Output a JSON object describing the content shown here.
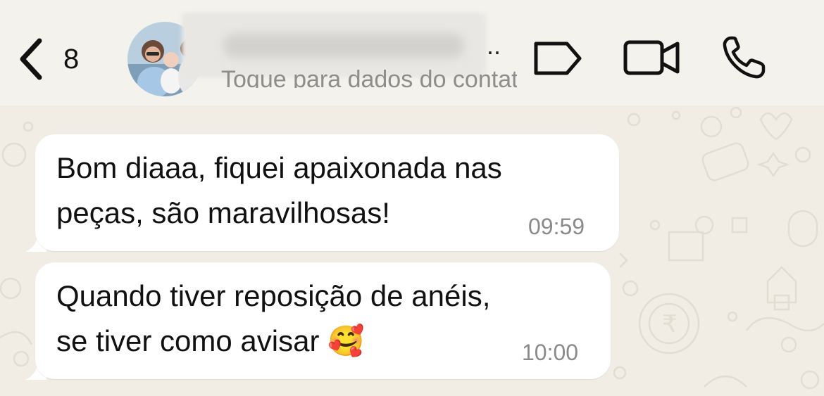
{
  "header": {
    "back_count": "8",
    "contact_name_hidden": "",
    "subtitle": "Toque para dados do contato",
    "icons": [
      "chevron-left-icon",
      "tag-icon",
      "video-call-icon",
      "phone-icon"
    ]
  },
  "messages": [
    {
      "text": "Bom diaaa, fiquei apaixonada nas\npeças, são maravilhosas!",
      "time": "09:59"
    },
    {
      "text": "Quando tiver reposição de anéis,\nse tiver como avisar 🥰",
      "time": "10:00"
    }
  ],
  "colors": {
    "background": "#f1ede4",
    "bubble": "#ffffff",
    "text": "#111111",
    "time": "#8a8a8a"
  }
}
